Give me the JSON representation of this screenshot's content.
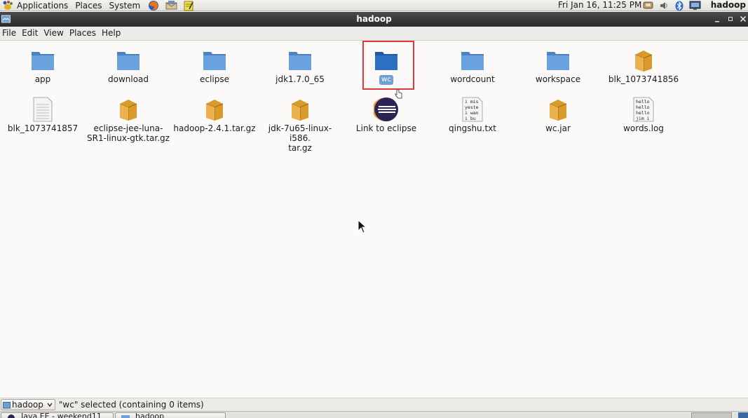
{
  "panel": {
    "menus": [
      "Applications",
      "Places",
      "System"
    ],
    "launchers": [
      "firefox-icon",
      "mail-icon",
      "notes-icon"
    ],
    "clock": "Fri Jan 16, 11:25 PM",
    "tray": [
      "network-icon",
      "volume-icon",
      "bluetooth-icon",
      "display-icon"
    ],
    "user": "hadoop"
  },
  "window": {
    "title": "hadoop",
    "controls": [
      "minimize",
      "maximize",
      "close"
    ]
  },
  "menubar": [
    "File",
    "Edit",
    "View",
    "Places",
    "Help"
  ],
  "files": [
    {
      "name": "app",
      "type": "folder"
    },
    {
      "name": "download",
      "type": "folder"
    },
    {
      "name": "eclipse",
      "type": "folder"
    },
    {
      "name": "jdk1.7.0_65",
      "type": "folder"
    },
    {
      "name": "wc",
      "type": "folder",
      "selected": true
    },
    {
      "name": "wordcount",
      "type": "folder"
    },
    {
      "name": "workspace",
      "type": "folder"
    },
    {
      "name": "blk_1073741856",
      "type": "package"
    },
    {
      "name": "blk_1073741857",
      "type": "text-file"
    },
    {
      "name": "eclipse-jee-luna-SR1-linux-gtk.tar.gz",
      "display": "eclipse-jee-luna-\nSR1-linux-gtk.tar.gz",
      "type": "package"
    },
    {
      "name": "hadoop-2.4.1.tar.gz",
      "type": "package"
    },
    {
      "name": "jdk-7u65-linux-i586.tar.gz",
      "display": "jdk-7u65-linux-i586.\ntar.gz",
      "type": "package"
    },
    {
      "name": "Link to eclipse",
      "type": "eclipse-link"
    },
    {
      "name": "qingshu.txt",
      "type": "text-preview",
      "preview": [
        "i mis",
        "yeste",
        "i wan",
        "i bu"
      ]
    },
    {
      "name": "wc.jar",
      "type": "package"
    },
    {
      "name": "words.log",
      "type": "text-preview",
      "preview": [
        "hello",
        "hello",
        "hello",
        "jim i"
      ]
    }
  ],
  "statusbar": {
    "location": "hadoop",
    "status": "\"wc\" selected (containing 0 items)"
  },
  "taskbar": {
    "tasks": [
      "Java EE - weekend11",
      "hadoop"
    ]
  },
  "colors": {
    "folder": "#5b93cf",
    "package": "#e0a33a",
    "selection": "#6f9fd8",
    "highlight": "#e0393e"
  }
}
